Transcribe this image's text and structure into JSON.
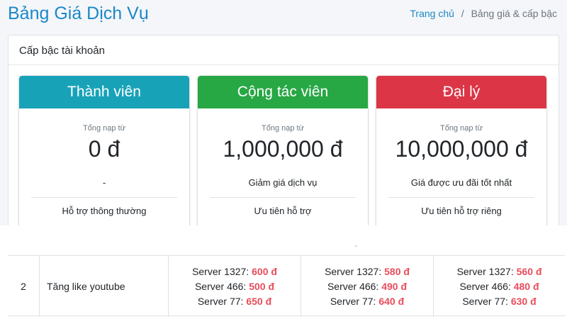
{
  "header": {
    "title": "Bảng Giá Dịch Vụ",
    "breadcrumb": {
      "home": "Trang chủ",
      "separator": "/",
      "current": "Bảng giá & cấp bậc"
    }
  },
  "levels_card": {
    "title": "Cấp bậc tài khoản",
    "tiers": [
      {
        "name": "Thành viên",
        "color": "#17a2b8",
        "sub_label": "Tổng nạp từ",
        "amount": "0 đ",
        "benefit1": "-",
        "benefit2": "Hỗ trợ thông thường"
      },
      {
        "name": "Cộng tác viên",
        "color": "#28a745",
        "sub_label": "Tổng nạp từ",
        "amount": "1,000,000 đ",
        "benefit1": "Giảm giá dịch vụ",
        "benefit2": "Ưu tiên hỗ trợ"
      },
      {
        "name": "Đại lý",
        "color": "#dc3545",
        "sub_label": "Tổng nạp từ",
        "amount": "10,000,000 đ",
        "benefit1": "Giá được ưu đãi tốt nhất",
        "benefit2": "Ưu tiên hỗ trợ riêng"
      }
    ]
  },
  "price_table": {
    "row": {
      "index": "2",
      "service": "Tăng like youtube",
      "columns": [
        [
          {
            "server": "Server 1327: ",
            "price": "600 đ"
          },
          {
            "server": "Server 466: ",
            "price": "500 đ"
          },
          {
            "server": "Server 77: ",
            "price": "650 đ"
          }
        ],
        [
          {
            "server": "Server 1327: ",
            "price": "580 đ"
          },
          {
            "server": "Server 466: ",
            "price": "490 đ"
          },
          {
            "server": "Server 77: ",
            "price": "640 đ"
          }
        ],
        [
          {
            "server": "Server 1327: ",
            "price": "560 đ"
          },
          {
            "server": "Server 466: ",
            "price": "480 đ"
          },
          {
            "server": "Server 77: ",
            "price": "630 đ"
          }
        ]
      ]
    }
  },
  "colors": {
    "accent": "#1b87c9",
    "price": "#e84d5b"
  }
}
